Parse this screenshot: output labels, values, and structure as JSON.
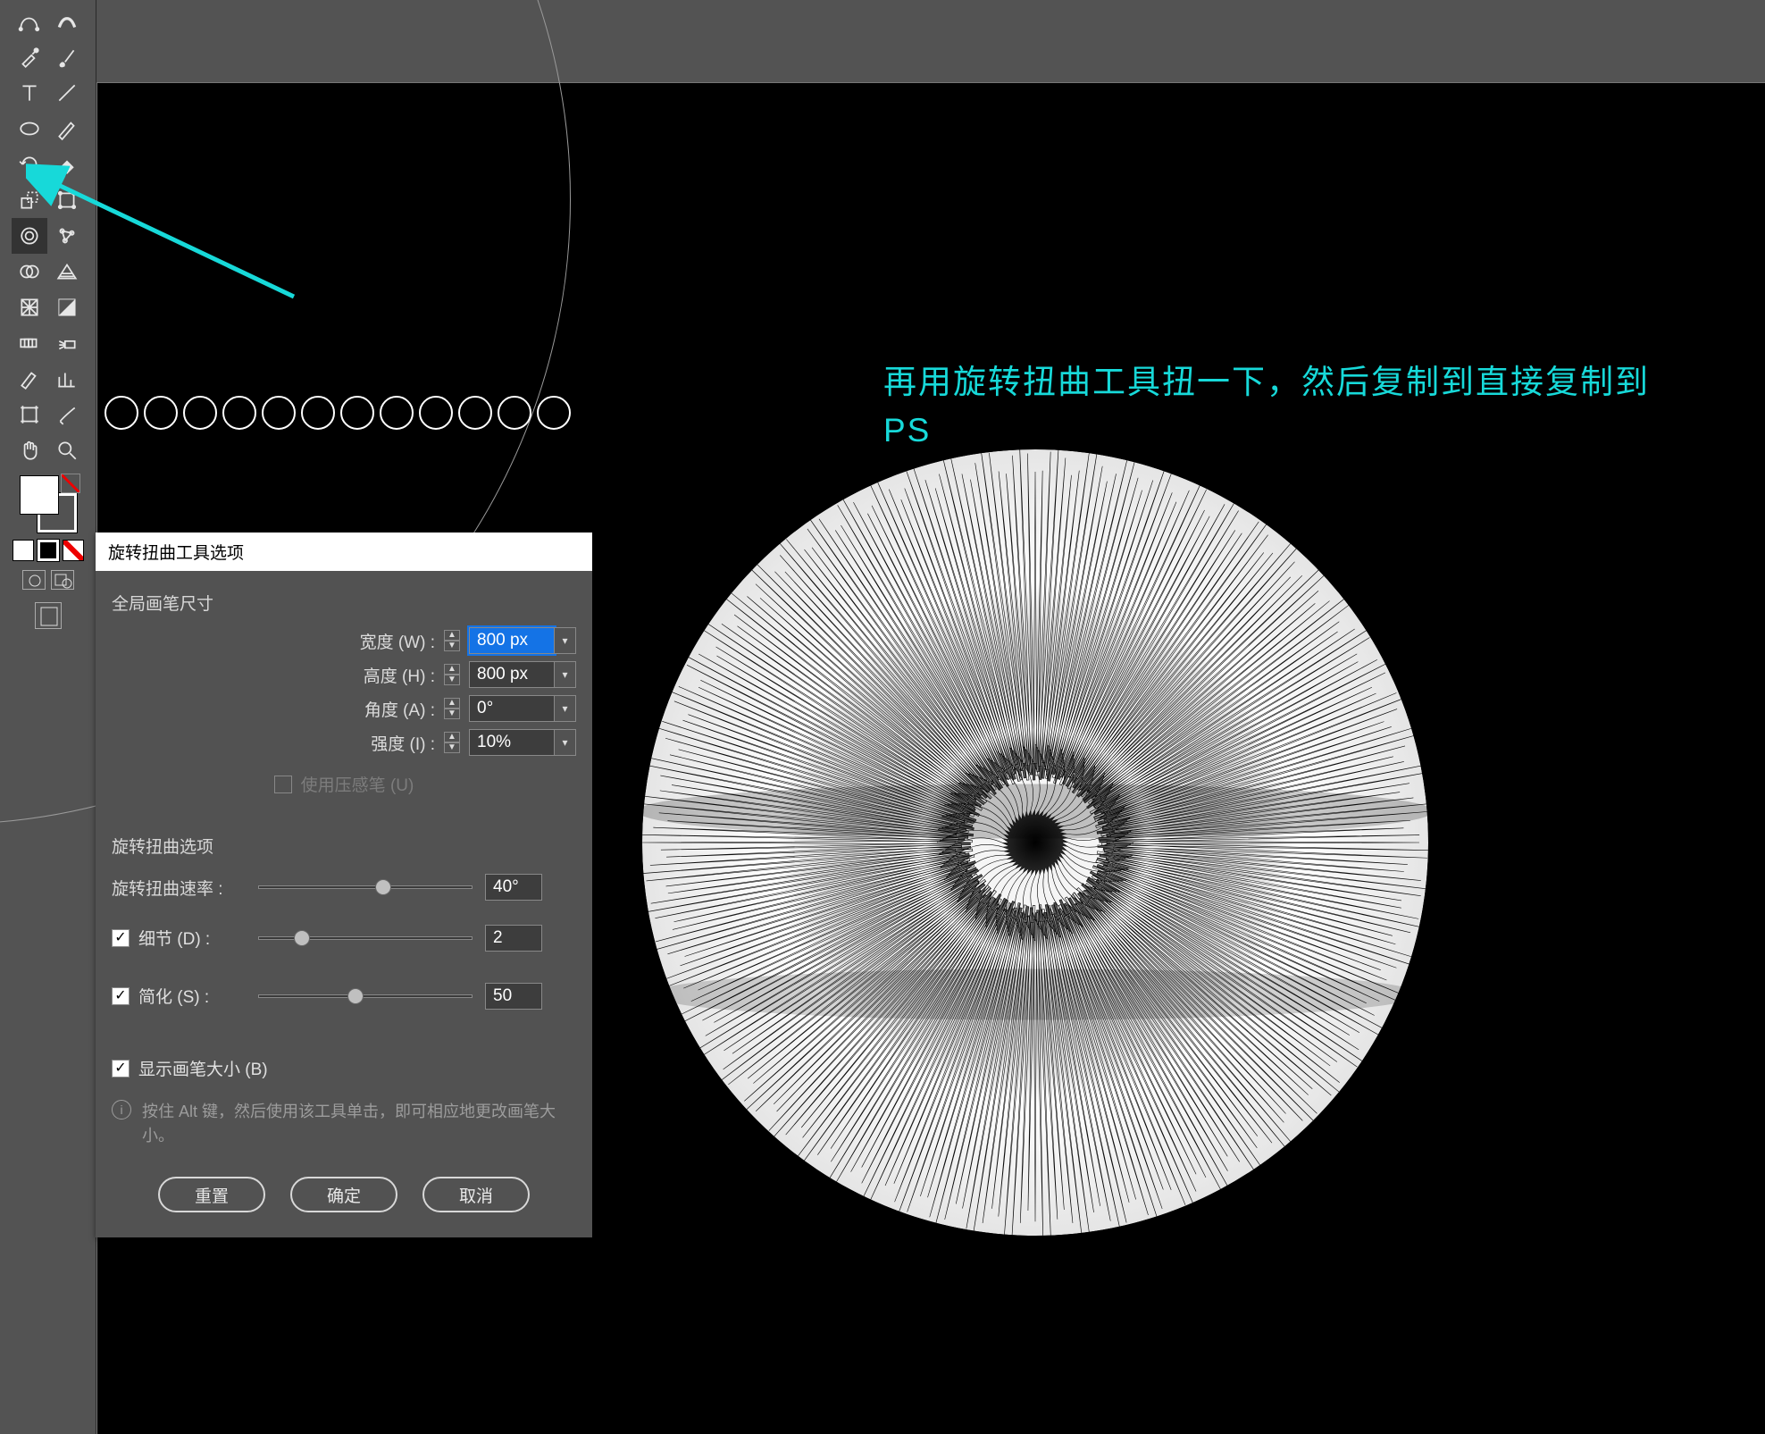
{
  "annotation": {
    "line1": "再用旋转扭曲工具扭一下，然后复制到直接复制到",
    "line2": "PS"
  },
  "dialog": {
    "title": "旋转扭曲工具选项",
    "section_brush": "全局画笔尺寸",
    "width_label": "宽度 (W) :",
    "width_value": "800 px",
    "height_label": "高度 (H) :",
    "height_value": "800 px",
    "angle_label": "角度 (A) :",
    "angle_value": "0°",
    "intensity_label": "强度 (I) :",
    "intensity_value": "10%",
    "pressure_label": "使用压感笔 (U)",
    "section_twirl": "旋转扭曲选项",
    "rate_label": "旋转扭曲速率 :",
    "rate_value": "40°",
    "detail_label": "细节 (D) :",
    "detail_value": "2",
    "simplify_label": "简化 (S) :",
    "simplify_value": "50",
    "show_brush_label": "显示画笔大小 (B)",
    "tip_text": "按住 Alt 键，然后使用该工具单击，即可相应地更改画笔大小。",
    "reset": "重置",
    "ok": "确定",
    "cancel": "取消"
  },
  "slider_positions": {
    "rate_pct": 58,
    "detail_pct": 20,
    "simplify_pct": 45
  }
}
